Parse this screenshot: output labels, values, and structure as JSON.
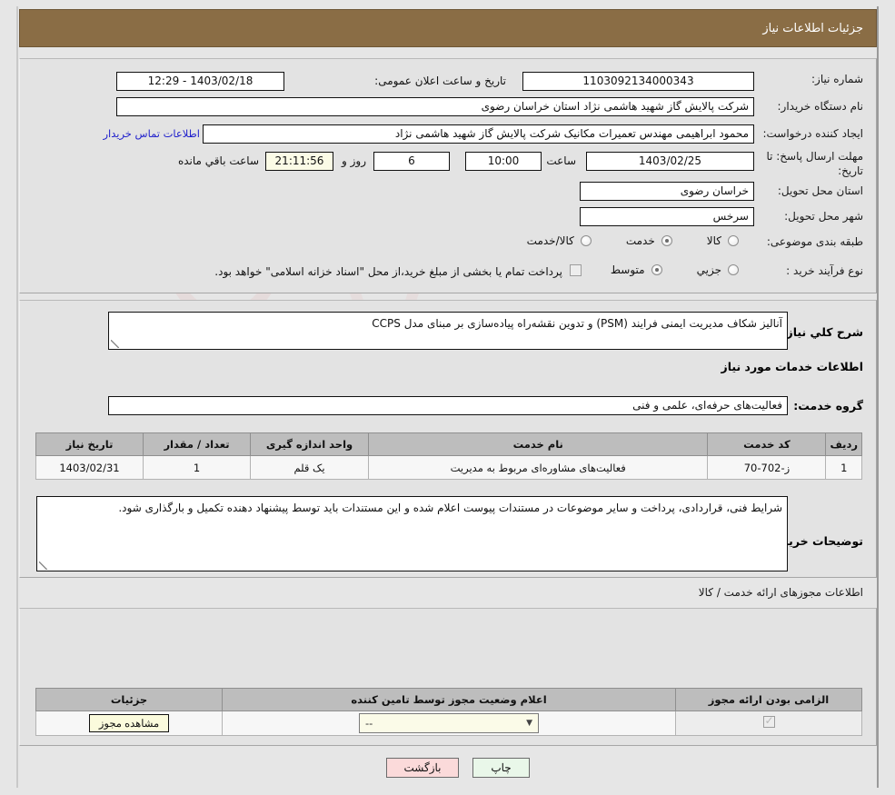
{
  "header": {
    "title": "جزئیات اطلاعات نیاز"
  },
  "form": {
    "need_number_label": "شماره نیاز:",
    "need_number_value": "1103092134000343",
    "public_announce_label": "تاریخ و ساعت اعلان عمومی:",
    "public_announce_value": "1403/02/18 - 12:29",
    "buyer_org_label": "نام دستگاه خریدار:",
    "buyer_org_value": "شرکت پالایش گاز شهید هاشمی نژاد   استان خراسان رضوی",
    "requester_label": "ایجاد کننده درخواست:",
    "requester_value": "محمود ابراهیمی مهندس تعمیرات مکانیک شرکت پالایش گاز شهید هاشمی نژاد",
    "contact_link": "اطلاعات تماس خریدار",
    "deadline_label": "مهلت ارسال پاسخ: تا تاریخ:",
    "deadline_date": "1403/02/25",
    "hour_label": "ساعت",
    "deadline_time": "10:00",
    "days_value": "6",
    "days_label": "روز و",
    "countdown_value": "21:11:56",
    "countdown_label": "ساعت باقي مانده",
    "province_label": "استان محل تحویل:",
    "province_value": "خراسان رضوی",
    "city_label": "شهر محل تحویل:",
    "city_value": "سرخس",
    "category_label": "طبقه بندی موضوعی:",
    "category_options": [
      {
        "label": "کالا",
        "selected": false
      },
      {
        "label": "خدمت",
        "selected": true
      },
      {
        "label": "کالا/خدمت",
        "selected": false
      }
    ],
    "process_label": "نوع فرآیند خرید :",
    "process_options": [
      {
        "label": "جزیي",
        "selected": false
      },
      {
        "label": "متوسط",
        "selected": true
      }
    ],
    "treasury_checkbox_checked": false,
    "treasury_note": "پرداخت تمام یا بخشی از مبلغ خرید،از محل \"اسناد خزانه اسلامی\" خواهد بود."
  },
  "need_summary": {
    "label": "شرح کلي نیاز:",
    "value": "آنالیز شکاف مدیریت ایمنی فرایند (PSM) و تدوین نقشه‌راه پیاده‌سازی بر مبنای مدل CCPS"
  },
  "services": {
    "section_title": "اطلاعات خدمات مورد نیاز",
    "group_label": "گروه خدمت:",
    "group_value": "فعالیت‌های حرفه‌ای، علمی و فنی",
    "columns": [
      "ردیف",
      "کد خدمت",
      "نام خدمت",
      "واحد اندازه گیری",
      "تعداد / مقدار",
      "تاریخ نیاز"
    ],
    "rows": [
      {
        "row": "1",
        "code": "ز-702-70",
        "name": "فعالیت‌های مشاوره‌ای مربوط به مدیریت",
        "unit": "یک قلم",
        "quantity": "1",
        "date": "1403/02/31"
      }
    ]
  },
  "buyer_notes": {
    "label": "توضیحات خریدار:",
    "value": "شرایط فنی، قراردادی، پرداخت و سایر موضوعات در مستندات پیوست اعلام شده و این مستندات باید توسط پیشنهاد دهنده تکمیل و  بارگذاری شود."
  },
  "permits": {
    "section_title": "اطلاعات مجوزهای ارائه خدمت / کالا",
    "columns": [
      "الزامی بودن ارائه مجوز",
      "اعلام وضعیت مجوز توسط تامین کننده",
      "جزئیات"
    ],
    "rows": [
      {
        "required_checked": true,
        "status_value": "--",
        "details_button": "مشاهده مجوز"
      }
    ]
  },
  "footer": {
    "print_label": "چاپ",
    "back_label": "بازگشت"
  },
  "watermark": {
    "text": "AriaTender.net"
  },
  "colors": {
    "header_bg": "#8a6d45",
    "panel_bg": "#e3e3e3",
    "link": "#2222cc",
    "print_btn": "#e9f7e9",
    "back_btn": "#fbdada",
    "cream": "#fbfbe6"
  }
}
